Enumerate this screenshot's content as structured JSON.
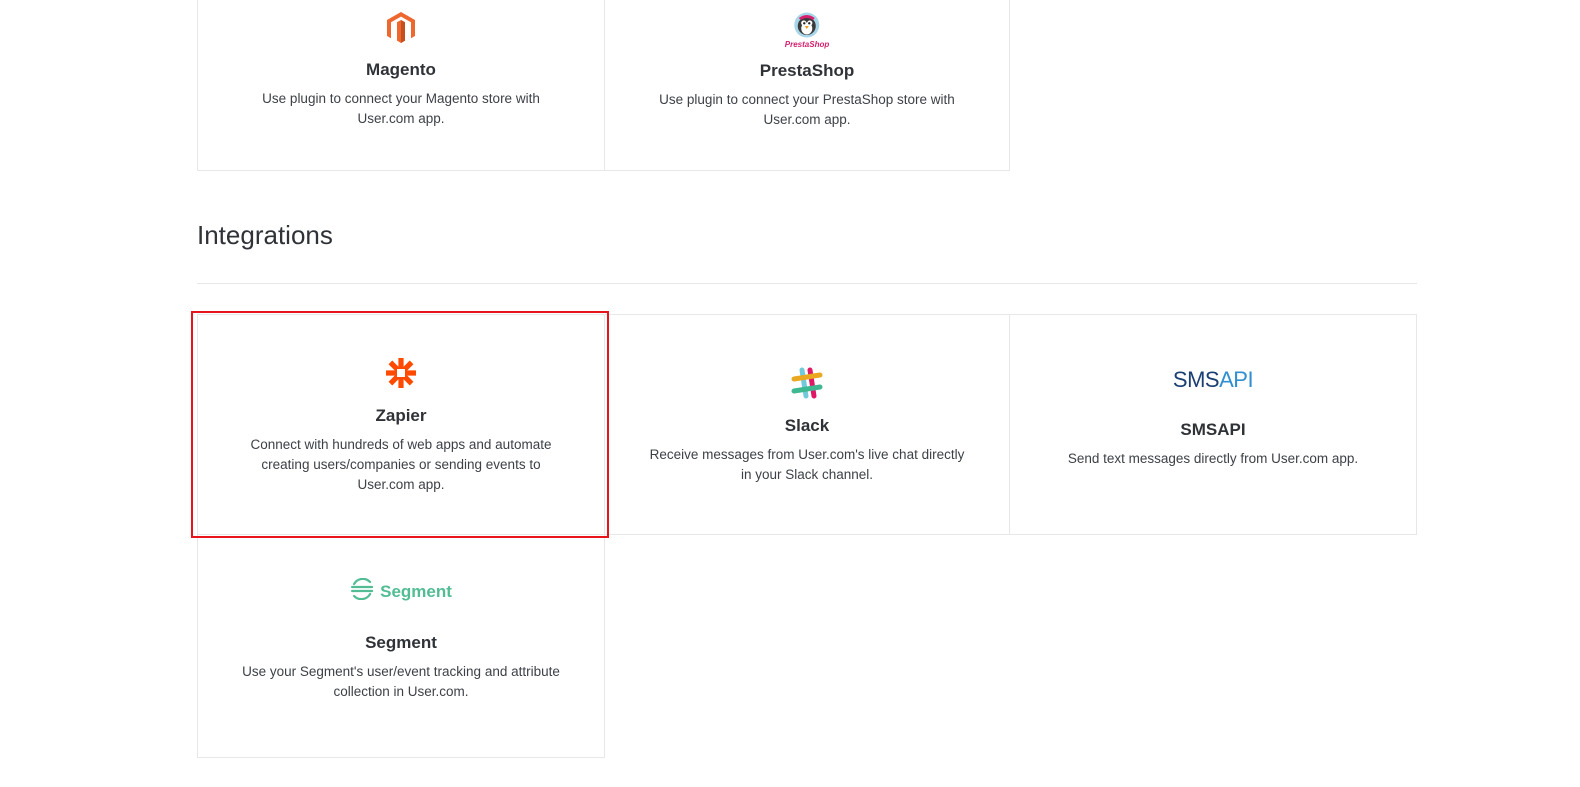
{
  "plugins": [
    {
      "name": "Magento",
      "description": "Use plugin to connect your Magento store with User.com app.",
      "logo_icon": "magento-logo-icon",
      "logo_color": "#ee672f"
    },
    {
      "name": "PrestaShop",
      "description": "Use plugin to connect your PrestaShop store with User.com app.",
      "logo_icon": "prestashop-logo-icon",
      "logo_text": "PrestaShop"
    }
  ],
  "integrations_section": {
    "title": "Integrations"
  },
  "integrations": [
    {
      "name": "Zapier",
      "description": "Connect with hundreds of web apps and automate creating users/companies or sending events to User.com app.",
      "logo_icon": "zapier-asterisk-icon",
      "logo_color": "#ff4a00",
      "highlighted": true
    },
    {
      "name": "Slack",
      "description": "Receive messages from User.com's live chat directly in your Slack channel.",
      "logo_icon": "slack-hash-icon"
    },
    {
      "name": "SMSAPI",
      "description": "Send text messages directly from User.com app.",
      "logo_icon": "smsapi-logo",
      "logo_text_a": "SMS",
      "logo_text_b": "API"
    },
    {
      "name": "Segment",
      "description": "Use your Segment's user/event tracking and attribute collection in User.com.",
      "logo_icon": "segment-logo-icon",
      "logo_text": "Segment",
      "logo_color": "#52bd94"
    }
  ],
  "colors": {
    "highlight_border": "#e8141b",
    "card_border": "#e6e7ea",
    "text": "#2f3237"
  }
}
